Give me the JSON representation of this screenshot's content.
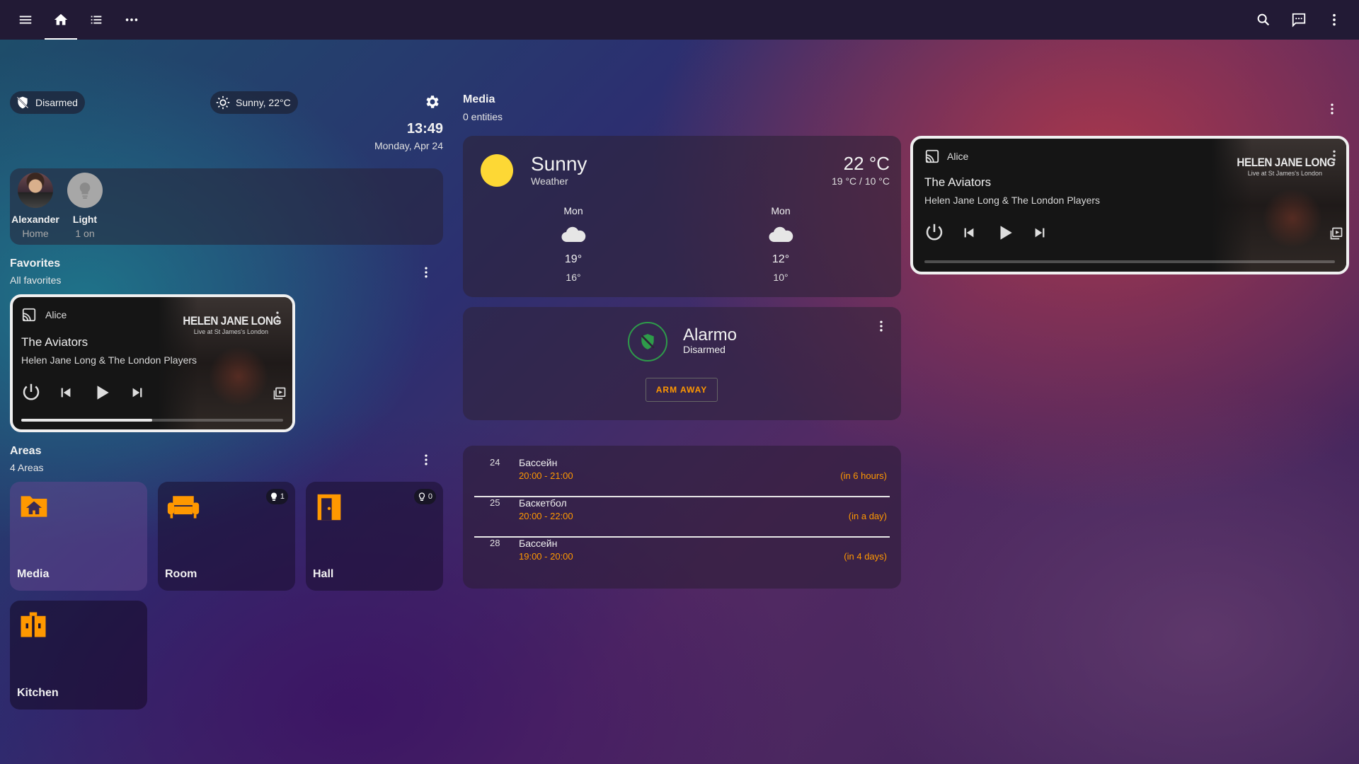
{
  "theme": {
    "accent": "#ff9800",
    "alarm_green": "#2e9b4a",
    "sun_yellow": "#fdd835"
  },
  "topbar": {
    "left_icons": [
      "menu-icon",
      "home-icon",
      "list-icon",
      "more-horizontal-icon"
    ],
    "right_icons": [
      "search-icon",
      "assist-icon",
      "more-vertical-icon"
    ]
  },
  "header": {
    "alarm_chip": "Disarmed",
    "weather_chip": "Sunny, 22°C",
    "time": "13:49",
    "date": "Monday, Apr 24"
  },
  "persons": [
    {
      "name": "Alexander",
      "state": "Home"
    },
    {
      "name": "Light",
      "state": "1 on"
    }
  ],
  "favorites": {
    "title": "Favorites",
    "subtitle": "All favorites",
    "player": {
      "source": "Alice",
      "title": "The Aviators",
      "artist": "Helen Jane Long & The London Players",
      "art_title": "HELEN JANE LONG",
      "art_subtitle": "Live at St James's London",
      "progress": 0.5
    }
  },
  "areas": {
    "title": "Areas",
    "subtitle": "4 Areas",
    "items": [
      {
        "name": "Media",
        "badge": ""
      },
      {
        "name": "Room",
        "badge": "1"
      },
      {
        "name": "Hall",
        "badge": "0"
      },
      {
        "name": "Kitchen",
        "badge": ""
      }
    ]
  },
  "media_section": {
    "title": "Media",
    "subtitle": "0 entities"
  },
  "weather": {
    "condition": "Sunny",
    "label": "Weather",
    "temp": "22 °C",
    "range": "19 °C / 10 °C",
    "forecast": [
      {
        "day": "Mon",
        "high": "19°",
        "low": "16°"
      },
      {
        "day": "Mon",
        "high": "12°",
        "low": "10°"
      }
    ]
  },
  "alarm": {
    "name": "Alarmo",
    "state": "Disarmed",
    "button": "ARM AWAY"
  },
  "calendar": [
    {
      "day": "24",
      "name": "Бассейн",
      "time": "20:00 - 21:00",
      "relative": "(in 6 hours)"
    },
    {
      "day": "25",
      "name": "Баскетбол",
      "time": "20:00 - 22:00",
      "relative": "(in a day)"
    },
    {
      "day": "28",
      "name": "Бассейн",
      "time": "19:00 - 20:00",
      "relative": "(in 4 days)"
    }
  ],
  "right_player": {
    "source": "Alice",
    "title": "The Aviators",
    "artist": "Helen Jane Long & The London Players",
    "art_title": "HELEN JANE LONG",
    "art_subtitle": "Live at St James's London",
    "progress": 0.0
  }
}
